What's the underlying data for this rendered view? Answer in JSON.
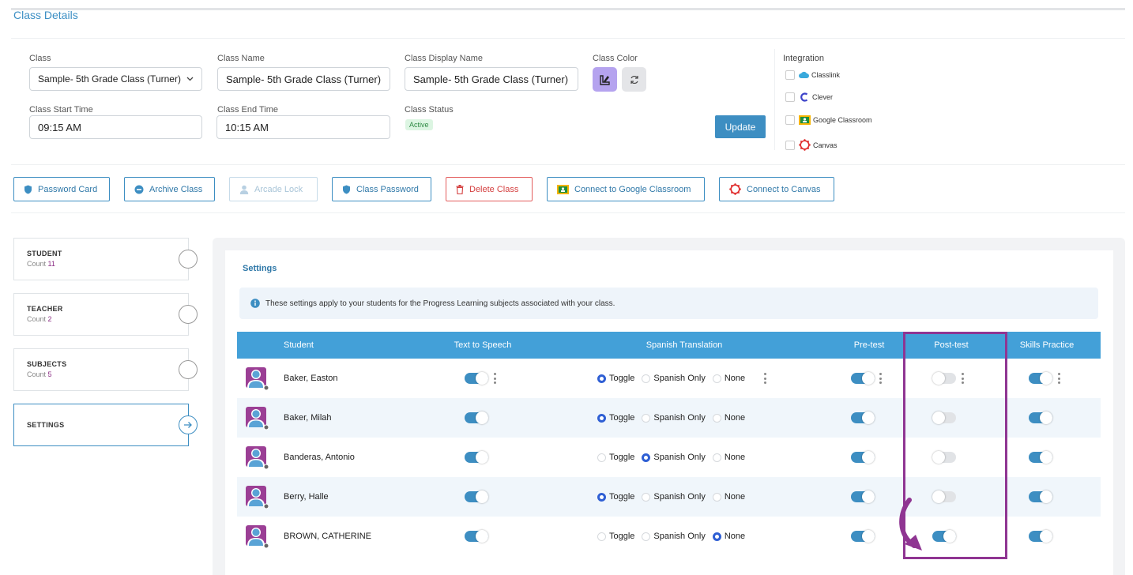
{
  "page": {
    "title": "Class Details"
  },
  "form": {
    "class_label": "Class",
    "class_value": "Sample- 5th Grade Class (Turner)",
    "class_name_label": "Class Name",
    "class_name_value": "Sample- 5th Grade Class (Turner)",
    "display_name_label": "Class Display Name",
    "display_name_value": "Sample- 5th Grade Class (Turner)",
    "color_label": "Class Color",
    "start_label": "Class Start Time",
    "start_value": "09:15 AM",
    "end_label": "Class End Time",
    "end_value": "10:15 AM",
    "status_label": "Class Status",
    "status_value": "Active",
    "update_label": "Update"
  },
  "integration": {
    "title": "Integration",
    "items": [
      {
        "label": "Classlink",
        "icon": "classlink-icon"
      },
      {
        "label": "Clever",
        "icon": "clever-icon"
      },
      {
        "label": "Google Classroom",
        "icon": "google-classroom-icon"
      },
      {
        "label": "Canvas",
        "icon": "canvas-icon"
      }
    ]
  },
  "actions": {
    "password_card": "Password Card",
    "archive_class": "Archive Class",
    "arcade_lock": "Arcade Lock",
    "class_password": "Class Password",
    "delete_class": "Delete Class",
    "connect_google": "Connect to Google Classroom",
    "connect_canvas": "Connect to Canvas"
  },
  "sidebar": {
    "count_label": "Count",
    "items": [
      {
        "title": "STUDENT",
        "count": "11"
      },
      {
        "title": "TEACHER",
        "count": "2"
      },
      {
        "title": "SUBJECTS",
        "count": "5"
      },
      {
        "title": "SETTINGS"
      }
    ]
  },
  "settings": {
    "title": "Settings",
    "info": "These settings apply to your students for the Progress Learning subjects associated with your class.",
    "columns": {
      "student": "Student",
      "tts": "Text to Speech",
      "spanish": "Spanish Translation",
      "pretest": "Pre-test",
      "posttest": "Post-test",
      "skills": "Skills Practice"
    },
    "radio_labels": {
      "toggle": "Toggle",
      "spanish_only": "Spanish Only",
      "none": "None"
    },
    "rows": [
      {
        "name": "Baker, Easton",
        "tts": true,
        "spanish": "toggle",
        "pretest": true,
        "posttest": false,
        "skills": true
      },
      {
        "name": "Baker, Milah",
        "tts": true,
        "spanish": "toggle",
        "pretest": true,
        "posttest": false,
        "skills": true
      },
      {
        "name": "Banderas, Antonio",
        "tts": true,
        "spanish": "spanish_only",
        "pretest": true,
        "posttest": false,
        "skills": true
      },
      {
        "name": "Berry, Halle",
        "tts": true,
        "spanish": "toggle",
        "pretest": true,
        "posttest": false,
        "skills": true
      },
      {
        "name": "BROWN, CATHERINE",
        "tts": true,
        "spanish": "none",
        "pretest": true,
        "posttest": true,
        "skills": true
      }
    ]
  },
  "colors": {
    "accent": "#3d8ec2",
    "table_header": "#43a0d8",
    "highlight": "#8f3592",
    "danger": "#d43f3f",
    "count_number": "#8d2f86"
  }
}
